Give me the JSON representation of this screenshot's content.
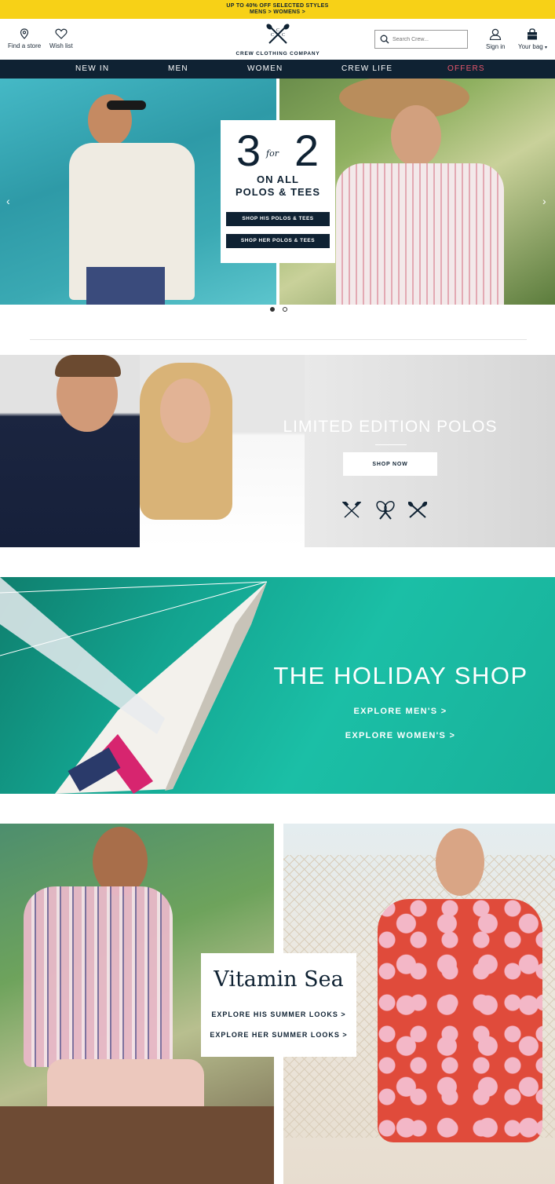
{
  "promo": {
    "line1": "UP TO 40% OFF SELECTED STYLES",
    "line2": "MENS > WOMENS >"
  },
  "header": {
    "find_store": "Find a store",
    "wish_list": "Wish list",
    "brand": "CREW CLOTHING COMPANY",
    "search_placeholder": "Search Crew...",
    "sign_in": "Sign in",
    "bag": "Your bag"
  },
  "nav": {
    "items": [
      {
        "label": "NEW IN"
      },
      {
        "label": "MEN"
      },
      {
        "label": "WOMEN"
      },
      {
        "label": "CREW LIFE"
      },
      {
        "label": "OFFERS"
      }
    ]
  },
  "hero": {
    "num_left": "3",
    "for_text": "for",
    "num_right": "2",
    "line1": "ON ALL",
    "line2": "POLOS & TEES",
    "btn_his": "SHOP HIS POLOS & TEES",
    "btn_her": "SHOP HER POLOS & TEES",
    "slide_count": 2,
    "active_slide": 1
  },
  "polos": {
    "title": "LIMITED EDITION POLOS",
    "button": "SHOP NOW"
  },
  "holiday": {
    "title": "THE HOLIDAY SHOP",
    "mens": "EXPLORE MEN'S >",
    "womens": "EXPLORE WOMEN'S >"
  },
  "vitamin": {
    "title": "Vitamin Sea",
    "his": "EXPLORE HIS SUMMER LOOKS >",
    "her": "EXPLORE HER SUMMER LOOKS >"
  },
  "colors": {
    "navy": "#0f2233",
    "promo_yellow": "#f7d117",
    "offer_pink": "#e8576c"
  },
  "icons": [
    "location-pin-icon",
    "heart-icon",
    "crossed-oars-logo",
    "search-icon",
    "user-icon",
    "bag-icon",
    "chevron-left-icon",
    "chevron-right-icon",
    "crossed-mallets-icon",
    "crossed-rackets-icon",
    "crossed-oars-icon"
  ]
}
